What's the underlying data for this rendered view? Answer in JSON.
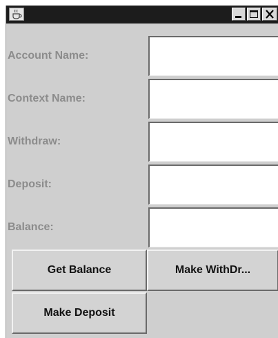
{
  "window": {
    "title": "",
    "icon": "java-cup-icon",
    "controls": [
      "minimize-icon",
      "maximize-icon",
      "close-icon"
    ]
  },
  "form": {
    "account_name_label": "Account Name:",
    "context_name_label": "Context Name:",
    "withdraw_label": "Withdraw:",
    "deposit_label": "Deposit:",
    "balance_label": "Balance:",
    "account_name_value": "",
    "context_name_value": "",
    "withdraw_value": "",
    "deposit_value": "",
    "balance_value": ""
  },
  "buttons": {
    "get_balance": "Get Balance",
    "make_withdraw": "Make WithDr...",
    "make_deposit": "Make Deposit"
  },
  "colors": {
    "titlebar": "#1c1c1c",
    "panel": "#cfcfcf",
    "label_text": "#8c8c8c",
    "field_bg": "#ffffff"
  }
}
